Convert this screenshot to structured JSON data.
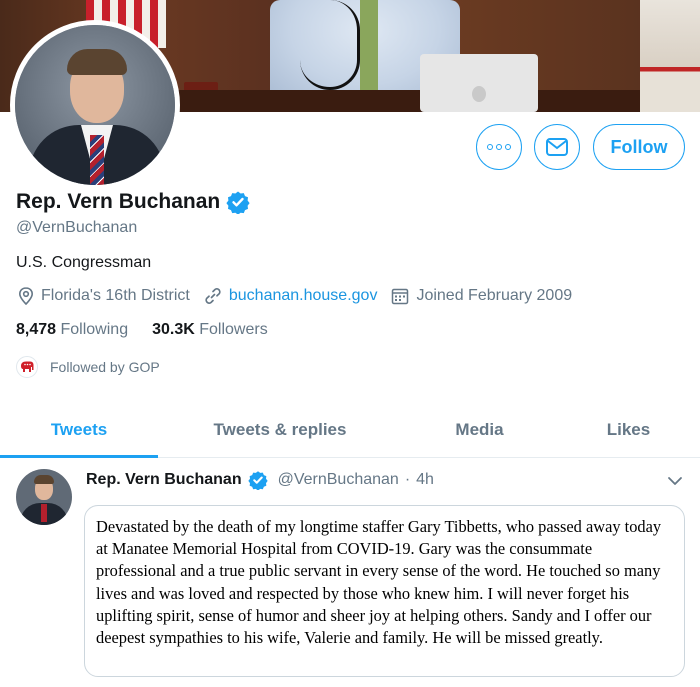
{
  "profile": {
    "name": "Rep. Vern Buchanan",
    "handle": "@VernBuchanan",
    "bio": "U.S. Congressman",
    "location": "Florida's 16th District",
    "website": "buchanan.house.gov",
    "joined": "Joined February 2009",
    "following_count": "8,478",
    "following_label": "Following",
    "followers_count": "30.3K",
    "followers_label": "Followers",
    "followed_by": "Followed by GOP"
  },
  "actions": {
    "follow_label": "Follow"
  },
  "tabs": [
    {
      "label": "Tweets",
      "active": true
    },
    {
      "label": "Tweets & replies",
      "active": false
    },
    {
      "label": "Media",
      "active": false
    },
    {
      "label": "Likes",
      "active": false
    }
  ],
  "tweet": {
    "author_name": "Rep. Vern Buchanan",
    "author_handle": "@VernBuchanan",
    "separator": "·",
    "time": "4h",
    "text": "Devastated by the death of my longtime staffer Gary Tibbetts, who passed away today at Manatee Memorial Hospital from COVID-19. Gary was the consummate professional and a true public servant in every sense of the word. He touched so many lives and was loved and respected by those who knew him. I will never forget his uplifting spirit, sense of humor and sheer joy at helping others. Sandy and I offer our deepest sympathies to his wife, Valerie and family. He will be missed greatly."
  },
  "colors": {
    "accent": "#1da1f2",
    "link": "#1b95e0",
    "secondary_text": "#657786",
    "gop_red": "#d0202a"
  },
  "icons": [
    "more-icon",
    "mail-icon",
    "verified-icon",
    "location-icon",
    "link-icon",
    "calendar-icon",
    "gop-elephant-icon",
    "chevron-down-icon"
  ]
}
